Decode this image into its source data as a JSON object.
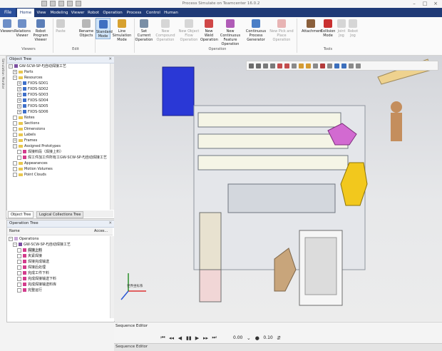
{
  "window": {
    "title": "Process Simulate on Teamcenter 16.0.2",
    "controls": [
      "–",
      "□",
      "×"
    ]
  },
  "tabs": [
    "Home",
    "View",
    "Modeling",
    "Viewer",
    "Robot",
    "Operation",
    "Process",
    "Control",
    "Human"
  ],
  "file_tab": "File",
  "ribbon": {
    "buttons": [
      {
        "label": "Viewers",
        "enabled": true
      },
      {
        "label": "Relations Viewer",
        "enabled": true
      },
      {
        "label": "Robot Program Viewer",
        "enabled": true
      },
      {
        "label": "Paste",
        "enabled": false
      },
      {
        "label": "Rename Objects",
        "enabled": true
      },
      {
        "label": "Standard Mode",
        "enabled": true,
        "selected": true
      },
      {
        "label": "Line Simulation Mode",
        "enabled": true
      },
      {
        "label": "Set Current Operation",
        "enabled": true
      },
      {
        "label": "New Compound Operation",
        "enabled": false
      },
      {
        "label": "New Object Flow Operation",
        "enabled": false
      },
      {
        "label": "New Weld Operation",
        "enabled": true
      },
      {
        "label": "New Continuous Feature Operation",
        "enabled": true
      },
      {
        "label": "Continuous Process Generator",
        "enabled": true
      },
      {
        "label": "New Pick and Place Operation",
        "enabled": false
      },
      {
        "label": "Attachment",
        "enabled": true
      },
      {
        "label": "Collision Mode",
        "enabled": true
      },
      {
        "label": "Joint Jog",
        "enabled": false
      },
      {
        "label": "Robot Jog",
        "enabled": false
      }
    ],
    "groups": [
      "Viewers",
      "Edit",
      "Operation",
      "Tools"
    ]
  },
  "side_strip_label": "Simulation Monitor",
  "object_tree": {
    "title": "Object Tree",
    "items": [
      {
        "label": "GW-SCW-SP-FJ自动焊接工艺",
        "level": 0,
        "icon": "study"
      },
      {
        "label": "Parts",
        "level": 1,
        "icon": "folder"
      },
      {
        "label": "Resources",
        "level": 1,
        "icon": "folder"
      },
      {
        "label": "FXDS-SD01",
        "level": 2,
        "icon": "resource"
      },
      {
        "label": "FXDS-SD02",
        "level": 2,
        "icon": "resource"
      },
      {
        "label": "FXDS-SD03",
        "level": 2,
        "icon": "resource"
      },
      {
        "label": "FXDS-SD04",
        "level": 2,
        "icon": "resource"
      },
      {
        "label": "FXDS-SD05",
        "level": 2,
        "icon": "resource"
      },
      {
        "label": "FXDS-SD06",
        "level": 2,
        "icon": "resource"
      },
      {
        "label": "Notes",
        "level": 1,
        "icon": "folder"
      },
      {
        "label": "Sections",
        "level": 1,
        "icon": "folder"
      },
      {
        "label": "Dimensions",
        "level": 1,
        "icon": "folder"
      },
      {
        "label": "Labels",
        "level": 1,
        "icon": "folder"
      },
      {
        "label": "Frames",
        "level": 1,
        "icon": "folder"
      },
      {
        "label": "Assigned Prototypes",
        "level": 1,
        "icon": "folder"
      },
      {
        "label": "焊接料段（焊接上料）",
        "level": 2,
        "icon": "op"
      },
      {
        "label": "焊工件加工件所有工GW-SCW-SP-FJ自动焊接工艺",
        "level": 2,
        "icon": "op"
      },
      {
        "label": "Appearances",
        "level": 1,
        "icon": "folder"
      },
      {
        "label": "Motion Volumes",
        "level": 1,
        "icon": "folder"
      },
      {
        "label": "Point Clouds",
        "level": 1,
        "icon": "folder"
      }
    ],
    "tabs": [
      "Object Tree",
      "Logical Collections Tree"
    ]
  },
  "operation_tree": {
    "title": "Operation Tree",
    "columns": [
      "Name",
      "Acces..."
    ],
    "items": [
      {
        "label": "Operations",
        "level": 0
      },
      {
        "label": "GW-SCW-SP-FJ自动焊接工艺",
        "level": 1
      },
      {
        "label": "焊接上料",
        "level": 2,
        "selected": true
      },
      {
        "label": "夹紧焊接",
        "level": 2
      },
      {
        "label": "焊接完成输送",
        "level": 2
      },
      {
        "label": "焊接后处理",
        "level": 2
      },
      {
        "label": "完成工件下料",
        "level": 2
      },
      {
        "label": "完成焊接输送下料",
        "level": 2
      },
      {
        "label": "完成焊接输送料库",
        "level": 2
      },
      {
        "label": "完整运行",
        "level": 2
      }
    ]
  },
  "sequence_editor": {
    "title": "Sequence Editor",
    "time": "0.00",
    "step": "0.10",
    "column": "Sequence Editor"
  },
  "viewport": {
    "axis_label": "世界坐标系"
  }
}
